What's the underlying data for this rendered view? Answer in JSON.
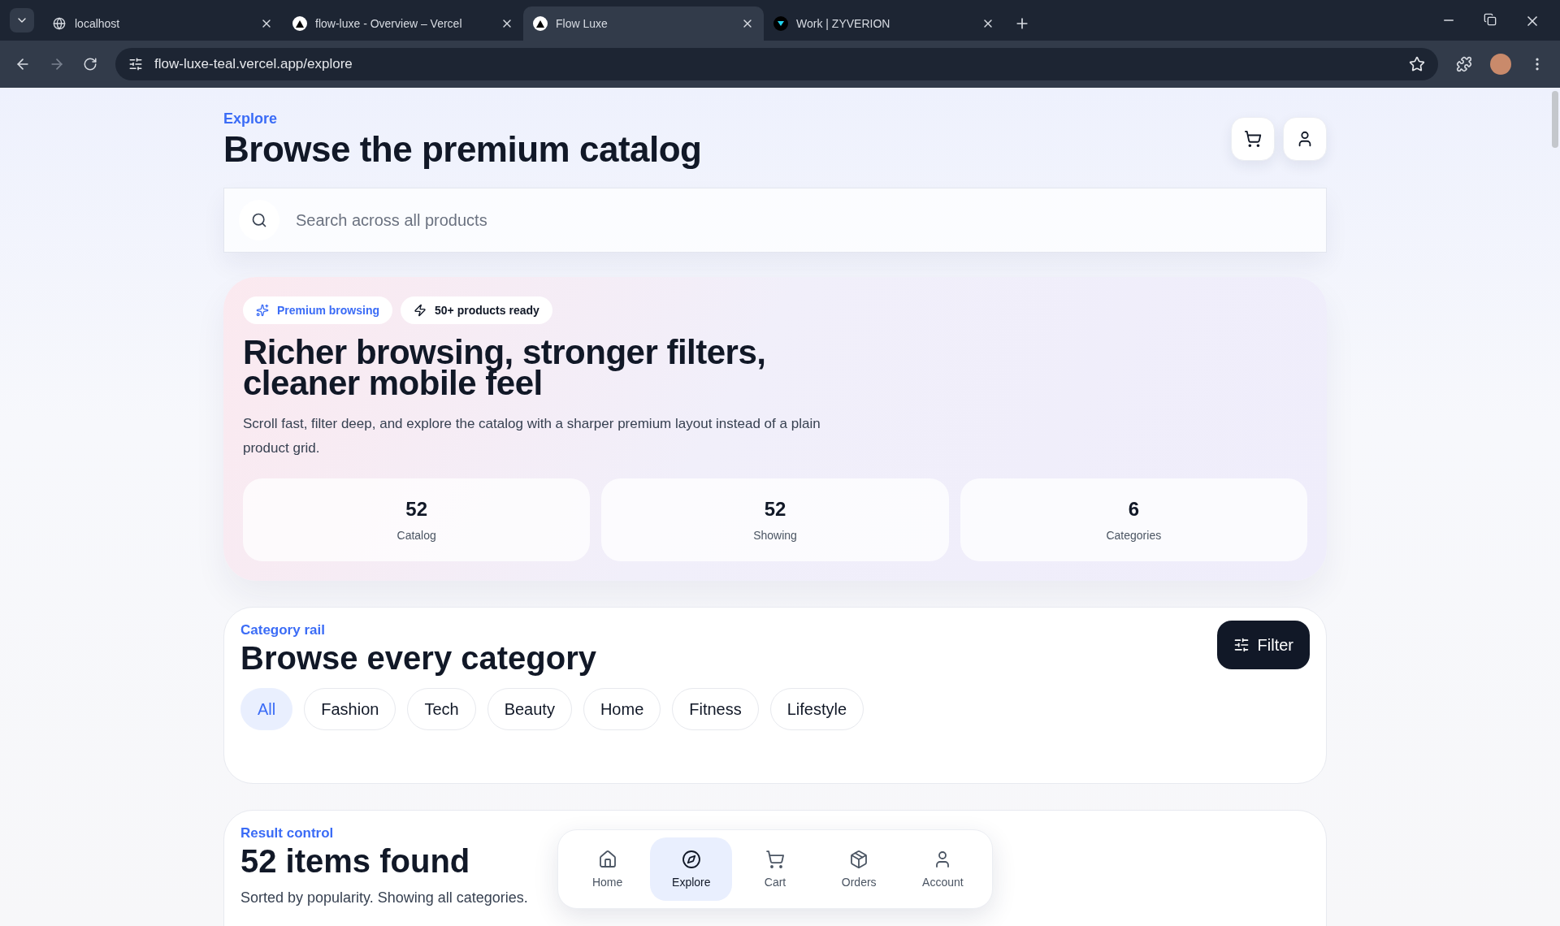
{
  "browser": {
    "tabs": [
      {
        "title": "localhost",
        "selected": false
      },
      {
        "title": "flow-luxe - Overview – Vercel",
        "selected": false
      },
      {
        "title": "Flow Luxe",
        "selected": true
      },
      {
        "title": "Work | ZYVERION",
        "selected": false
      }
    ],
    "url": "flow-luxe-teal.vercel.app/explore"
  },
  "header": {
    "eyebrow": "Explore",
    "title": "Browse the premium catalog"
  },
  "search": {
    "placeholder": "Search across all products"
  },
  "hero": {
    "badges": [
      {
        "label": "Premium browsing",
        "kind": "accent"
      },
      {
        "label": "50+ products ready",
        "kind": "plain"
      }
    ],
    "title": "Richer browsing, stronger filters, cleaner mobile feel",
    "text": "Scroll fast, filter deep, and explore the catalog with a sharper premium layout instead of a plain product grid.",
    "stats": [
      {
        "value": "52",
        "label": "Catalog"
      },
      {
        "value": "52",
        "label": "Showing"
      },
      {
        "value": "6",
        "label": "Categories"
      }
    ]
  },
  "categories": {
    "eyebrow": "Category rail",
    "title": "Browse every category",
    "filter_label": "Filter",
    "chips": [
      {
        "label": "All",
        "selected": true
      },
      {
        "label": "Fashion",
        "selected": false
      },
      {
        "label": "Tech",
        "selected": false
      },
      {
        "label": "Beauty",
        "selected": false
      },
      {
        "label": "Home",
        "selected": false
      },
      {
        "label": "Fitness",
        "selected": false
      },
      {
        "label": "Lifestyle",
        "selected": false
      }
    ]
  },
  "results": {
    "eyebrow": "Result control",
    "title": "52 items found",
    "text": "Sorted by popularity. Showing all categories."
  },
  "bottom_nav": [
    {
      "label": "Home",
      "selected": false
    },
    {
      "label": "Explore",
      "selected": true
    },
    {
      "label": "Cart",
      "selected": false
    },
    {
      "label": "Orders",
      "selected": false
    },
    {
      "label": "Account",
      "selected": false
    }
  ]
}
